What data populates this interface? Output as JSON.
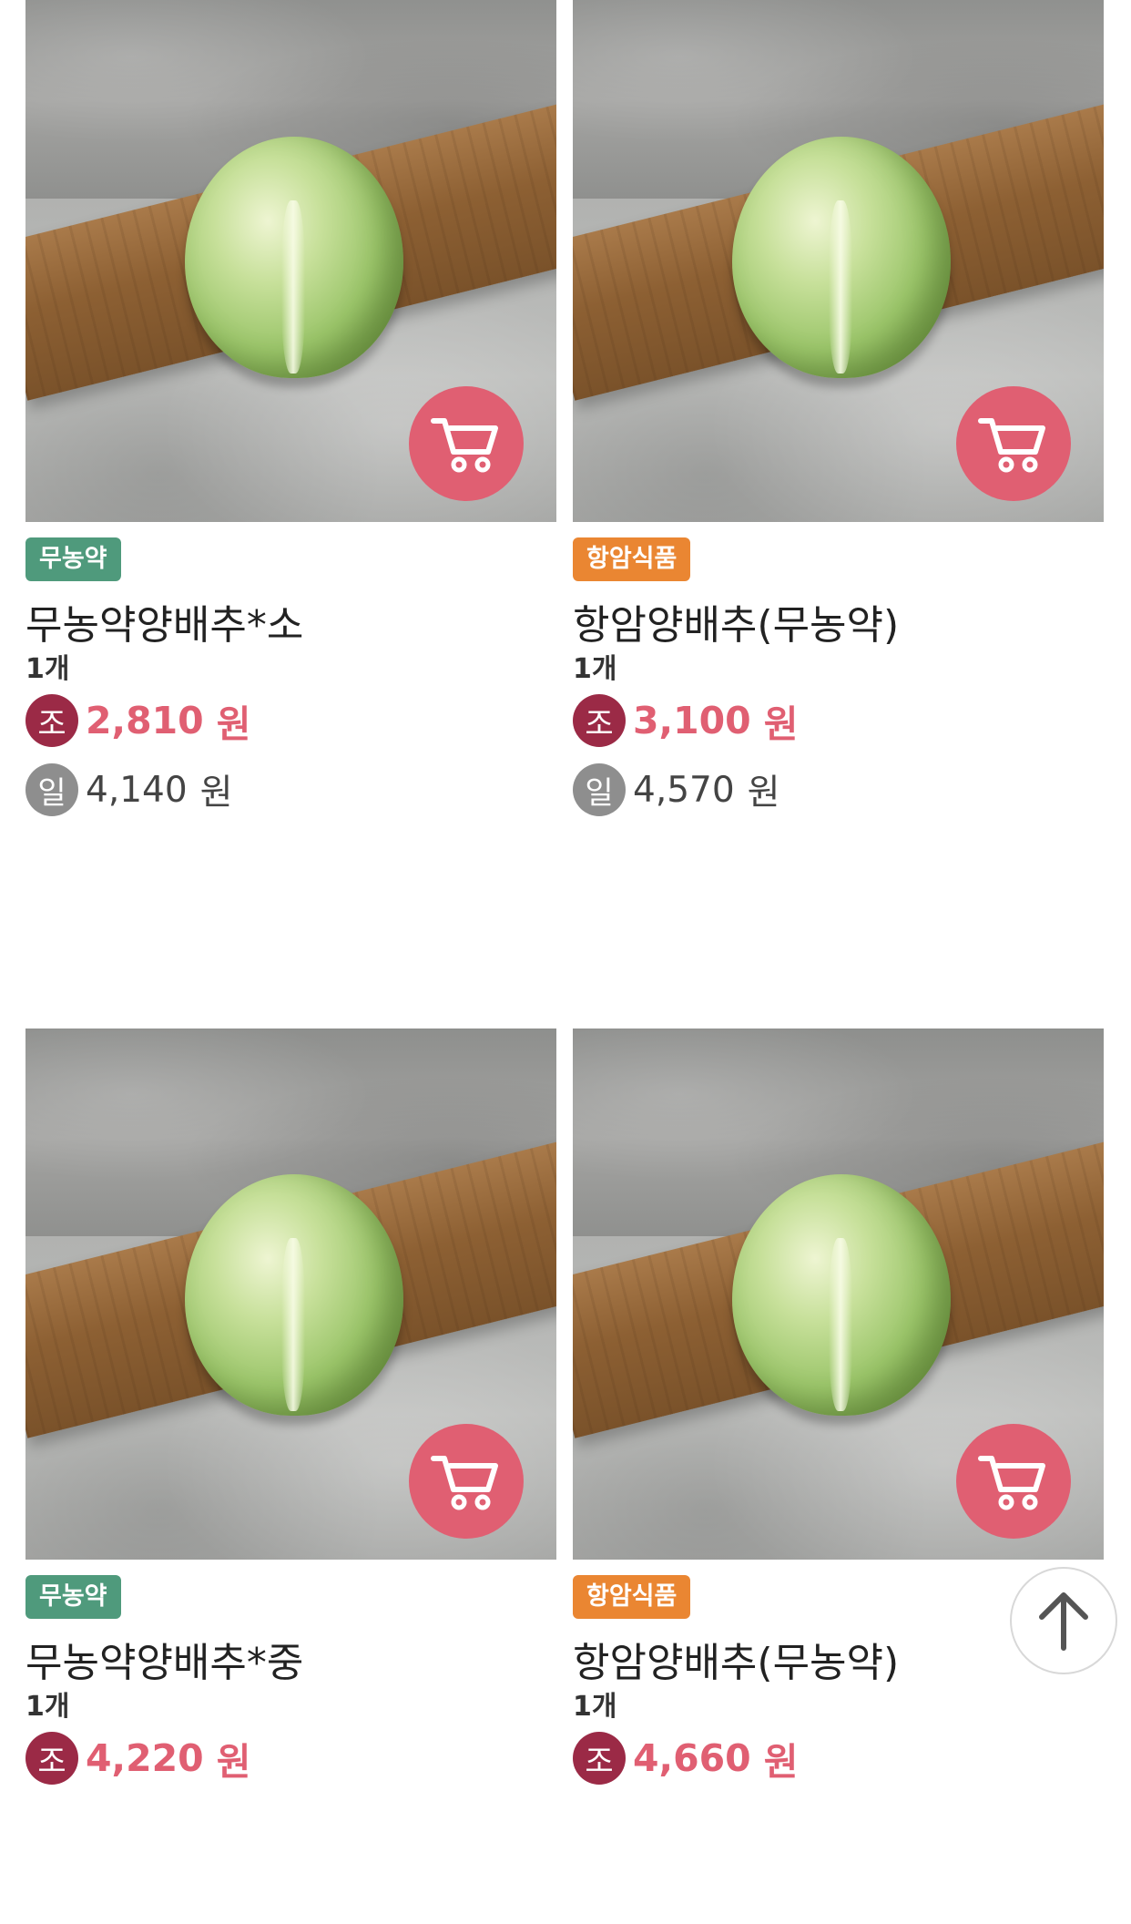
{
  "products": [
    {
      "badge": "무농약",
      "badge_color": "#4f9a7c",
      "name": "무농약양배추*소",
      "unit": "1개",
      "coop_badge": "조",
      "coop_price": "2,810",
      "coop_currency": "원",
      "general_badge": "일",
      "general_price": "4,140",
      "general_currency": "원",
      "cart_icon": "cart-icon"
    },
    {
      "badge": "항암식품",
      "badge_color": "#ea8632",
      "name": "항암양배추(무농약)",
      "unit": "1개",
      "coop_badge": "조",
      "coop_price": "3,100",
      "coop_currency": "원",
      "general_badge": "일",
      "general_price": "4,570",
      "general_currency": "원",
      "cart_icon": "cart-icon"
    },
    {
      "badge": "무농약",
      "badge_color": "#4f9a7c",
      "name": "무농약양배추*중",
      "unit": "1개",
      "coop_badge": "조",
      "coop_price": "4,220",
      "coop_currency": "원",
      "cart_icon": "cart-icon"
    },
    {
      "badge": "항암식품",
      "badge_color": "#ea8632",
      "name": "항암양배추(무농약)",
      "unit": "1개",
      "coop_badge": "조",
      "coop_price": "4,660",
      "coop_currency": "원",
      "cart_icon": "cart-icon"
    }
  ],
  "colors": {
    "accent_pink": "#e05f72",
    "coop_circle": "#9b2a46",
    "general_circle": "#8e8e8e"
  },
  "scroll_top_icon": "arrow-up-icon"
}
